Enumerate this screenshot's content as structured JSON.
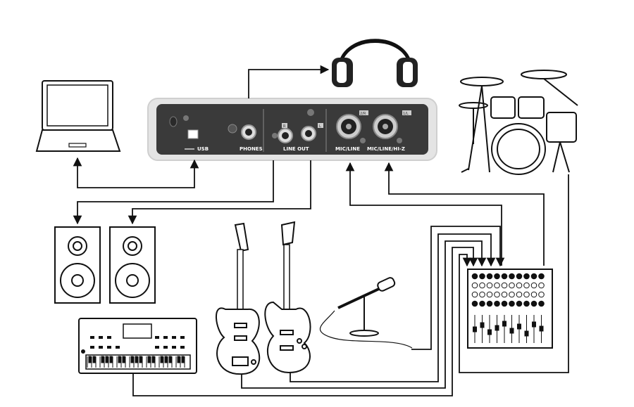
{
  "interface": {
    "usb_label": "USB",
    "phones_label": "PHONES",
    "line_out_label": "LINE OUT",
    "ch1_label": "MIC/LINE",
    "ch2_label": "MIC/LINE/HI-Z",
    "out_r": "R",
    "out_l": "L",
    "ch1_tag": "2/R",
    "ch2_tag": "1/L"
  },
  "colors": {
    "line": "#111111",
    "panel": "#3a3a3a",
    "bezel": "#e4e4e4",
    "device_fill": "#ffffff"
  },
  "icons": [
    "laptop-icon",
    "headphones-icon",
    "drum-kit-icon",
    "speaker-icon",
    "keyboard-icon",
    "electric-guitar-icon",
    "bass-guitar-icon",
    "microphone-icon",
    "mixer-icon"
  ]
}
